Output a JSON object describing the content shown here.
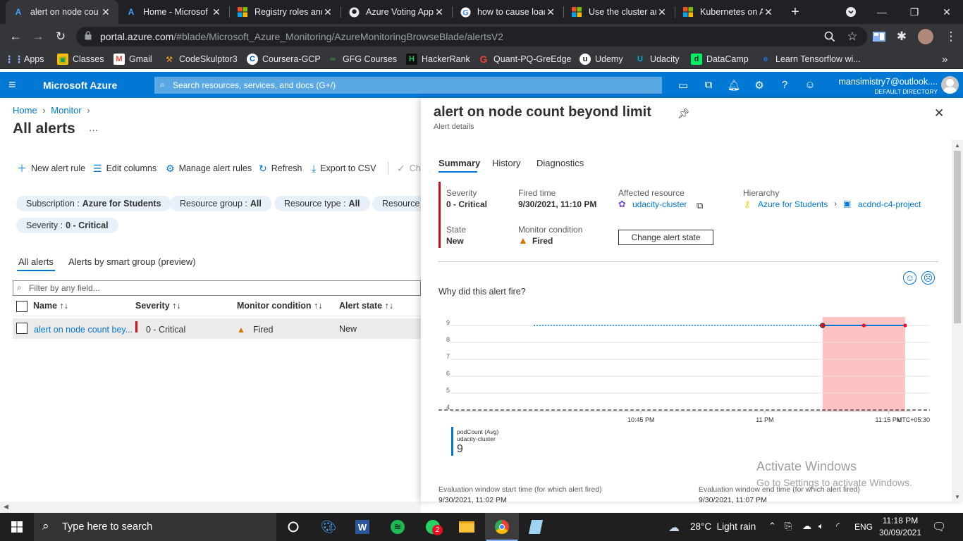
{
  "browser": {
    "tabs": [
      {
        "label": "alert on node cou",
        "active": true,
        "icon": "azure-icon"
      },
      {
        "label": "Home - Microsof",
        "icon": "azure-icon"
      },
      {
        "label": "Registry roles and",
        "icon": "microsoft-icon"
      },
      {
        "label": "Azure Voting App",
        "icon": "github-icon"
      },
      {
        "label": "how to cause load",
        "icon": "google-icon"
      },
      {
        "label": "Use the cluster au",
        "icon": "microsoft-icon"
      },
      {
        "label": "Kubernetes on Az",
        "icon": "microsoft-icon"
      }
    ],
    "url_host": "portal.azure.com",
    "url_path": "/#blade/Microsoft_Azure_Monitoring/AzureMonitoringBrowseBlade/alertsV2",
    "bookmarks": [
      "Apps",
      "Classes",
      "Gmail",
      "CodeSkulptor3",
      "Coursera-GCP",
      "GFG Courses",
      "HackerRank",
      "Quant-PQ-GreEdge",
      "Udemy",
      "Udacity",
      "DataCamp",
      "Learn Tensorflow wi..."
    ],
    "more_bookmarks": "»"
  },
  "azure": {
    "brand": "Microsoft Azure",
    "search_placeholder": "Search resources, services, and docs (G+/)",
    "user": "mansimistry7@outlook....",
    "directory": "DEFAULT DIRECTORY"
  },
  "left": {
    "breadcrumb": [
      "Home",
      "Monitor"
    ],
    "title": "All alerts",
    "more": "···",
    "commands": [
      "New alert rule",
      "Edit columns",
      "Manage alert rules",
      "Refresh",
      "Export to CSV",
      "Ch"
    ],
    "filters": [
      {
        "label": "Subscription :",
        "value": "Azure for Students"
      },
      {
        "label": "Resource group :",
        "value": "All"
      },
      {
        "label": "Resource type :",
        "value": "All"
      },
      {
        "label": "Resource :",
        "value": ""
      },
      {
        "label": "Severity :",
        "value": "0 - Critical"
      }
    ],
    "tabs": [
      "All alerts",
      "Alerts by smart group (preview)"
    ],
    "filter_placeholder": "Filter by any field...",
    "columns": [
      "Name ↑↓",
      "Severity ↑↓",
      "Monitor condition ↑↓",
      "Alert state ↑↓"
    ],
    "rows": [
      {
        "name": "alert on node count bey...",
        "severity": "0 - Critical",
        "condition": "Fired",
        "state": "New"
      }
    ]
  },
  "panel": {
    "title": "alert on node count beyond limit",
    "subtitle": "Alert details",
    "tabs": [
      "Summary",
      "History",
      "Diagnostics"
    ],
    "severity_label": "Severity",
    "severity": "0 - Critical",
    "fired_label": "Fired time",
    "fired": "9/30/2021, 11:10 PM",
    "resource_label": "Affected resource",
    "resource": "udacity-cluster",
    "hierarchy_label": "Hierarchy",
    "hierarchy": [
      "Azure for Students",
      "acdnd-c4-project"
    ],
    "state_label": "State",
    "state": "New",
    "condition_label": "Monitor condition",
    "condition": "Fired",
    "change_button": "Change alert state",
    "why": "Why did this alert fire?",
    "legend_metric": "podCount (Avg)",
    "legend_resource": "udacity-cluster",
    "legend_value": "9",
    "eval_start_label": "Evaluation window start time (for which alert fired)",
    "eval_start": "9/30/2021, 11:02 PM",
    "eval_end_label": "Evaluation window end time (for which alert fired)",
    "eval_end": "9/30/2021, 11:07 PM"
  },
  "chart_data": {
    "type": "line",
    "yticks": [
      "9",
      "8",
      "7",
      "6",
      "5",
      "4"
    ],
    "ylim": [
      4,
      9
    ],
    "xticks": [
      "10:45 PM",
      "11 PM",
      "11:15 PM"
    ],
    "timezone": "UTC+05:30",
    "threshold": 4,
    "series": [
      {
        "name": "podCount (Avg)",
        "values": [
          9,
          9,
          9,
          9
        ]
      }
    ],
    "x_minutes": [
      -28,
      7,
      12,
      17
    ],
    "highlight_range_minutes": [
      7,
      17
    ],
    "colors": {
      "line": "#0078d4",
      "highlight": "#fdc3c3",
      "points": "#e81123"
    }
  },
  "watermark": {
    "line1": "Activate Windows",
    "line2": "Go to Settings to activate Windows."
  },
  "taskbar": {
    "search_placeholder": "Type here to search",
    "weather": "28°C  Light rain",
    "lang": "ENG",
    "time": "11:18 PM",
    "date": "30/09/2021",
    "whatsapp_badge": "2"
  }
}
